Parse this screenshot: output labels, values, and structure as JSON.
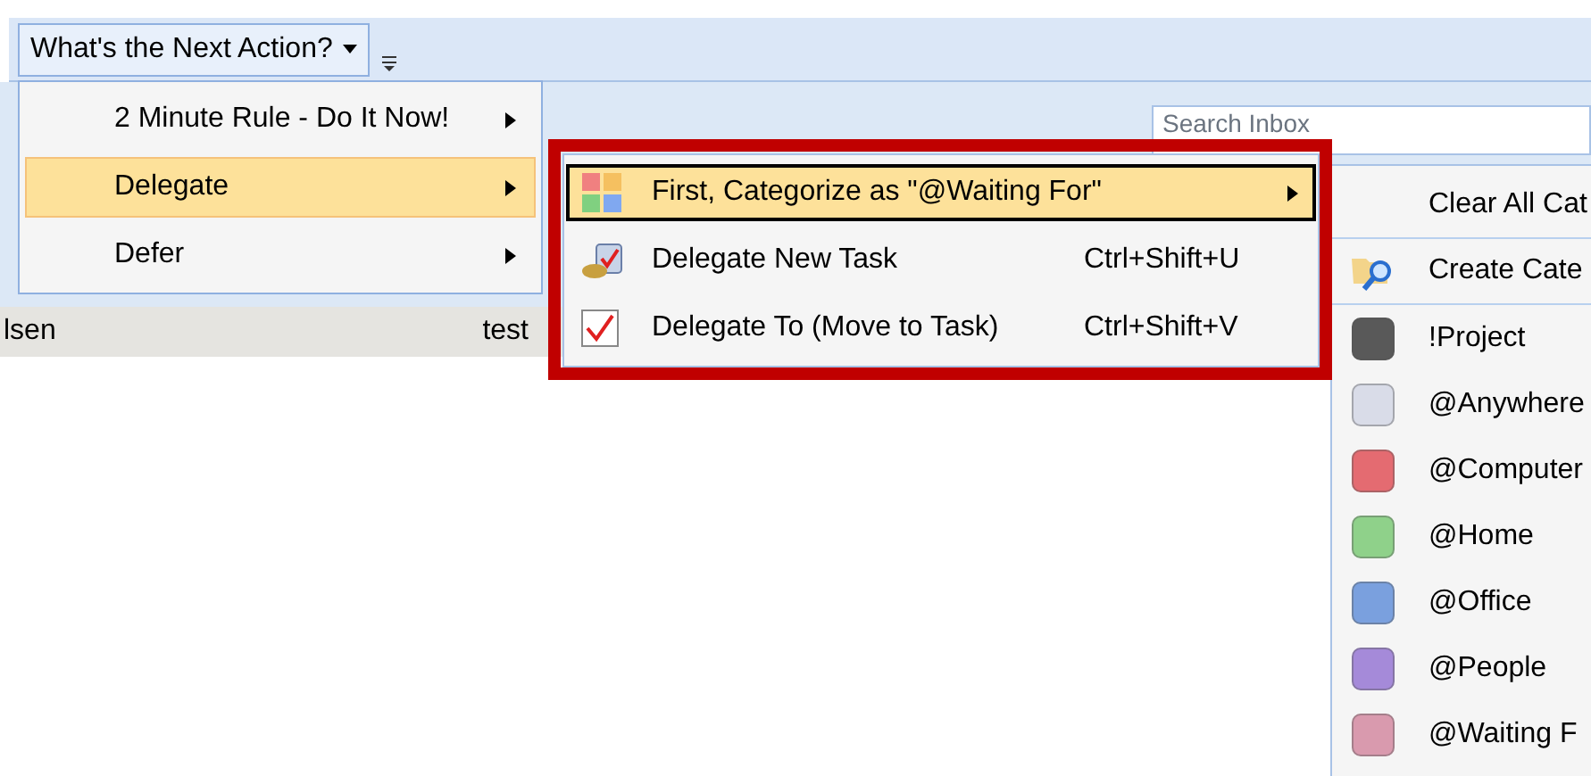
{
  "toolbar": {
    "menu_button": {
      "label": "What's the Next Action?"
    }
  },
  "search": {
    "placeholder": "Search Inbox"
  },
  "list_row": {
    "cells": [
      "lsen",
      "test"
    ]
  },
  "main_menu": {
    "items": [
      {
        "label": "2 Minute Rule - Do It Now!",
        "selected": false
      },
      {
        "label": "Delegate",
        "selected": true
      },
      {
        "label": "Defer",
        "selected": false
      }
    ]
  },
  "delegate_menu": {
    "items": [
      {
        "label": "First, Categorize as \"@Waiting For\"",
        "kind": "submenu",
        "selected": true
      },
      {
        "label": "Delegate New Task",
        "shortcut": "Ctrl+Shift+U",
        "kind": "task",
        "selected": false
      },
      {
        "label": "Delegate To (Move to Task)",
        "shortcut": "Ctrl+Shift+V",
        "kind": "check",
        "selected": false
      }
    ]
  },
  "category_menu": {
    "items": [
      {
        "label": "Clear All Cat",
        "kind": "clear"
      },
      {
        "label": "Create Cate",
        "kind": "create"
      },
      {
        "label": "!Project",
        "kind": "category",
        "color": "#595959"
      },
      {
        "label": "@Anywhere",
        "kind": "category",
        "color": "#d9dce8"
      },
      {
        "label": "@Computer",
        "kind": "category",
        "color": "#e46b71"
      },
      {
        "label": "@Home",
        "kind": "category",
        "color": "#8fd18a"
      },
      {
        "label": "@Office",
        "kind": "category",
        "color": "#7aa0de"
      },
      {
        "label": "@People",
        "kind": "category",
        "color": "#a58ad9"
      },
      {
        "label": "@Waiting F",
        "kind": "category",
        "color": "#d99aae"
      }
    ]
  }
}
